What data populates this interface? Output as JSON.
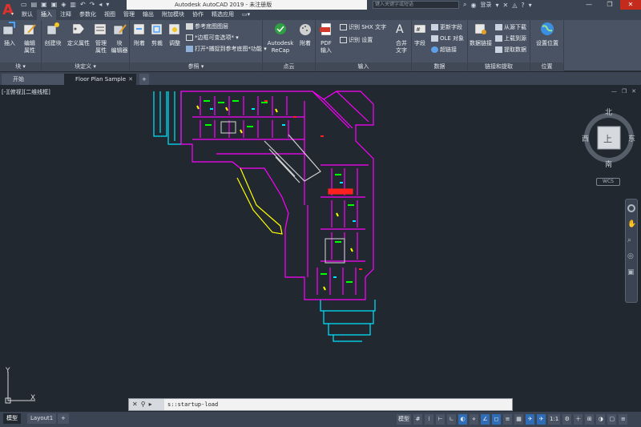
{
  "app": {
    "title": "Autodesk AutoCAD 2019 - 未注册版",
    "search_placeholder": "键入关键字或短语",
    "user_label": "登录"
  },
  "ribbon_tabs": [
    "默认",
    "插入",
    "注释",
    "参数化",
    "视图",
    "管理",
    "输出",
    "附加模块",
    "协作",
    "精选应用"
  ],
  "active_tab": "插入",
  "panels": {
    "block": {
      "label": "块 ▾",
      "insert": "插入",
      "edit_attr": "编辑\n属性"
    },
    "block_def": {
      "label": "块定义 ▾",
      "create": "创建块",
      "define_attr": "定义属性",
      "manage_attr": "管理\n属性",
      "block_editor": "块\n编辑器"
    },
    "reference": {
      "label": "参照 ▾",
      "attach": "附着",
      "clip": "剪裁",
      "adjust": "调整",
      "underlay_layers": "参考底图图层",
      "frame_variable": "*边框可变选项*",
      "snap_underlay": "打开*捕捉到参考底图*功能"
    },
    "point_cloud": {
      "label": "点云",
      "recap": "Autodesk\nReCap",
      "attach": "附着"
    },
    "import": {
      "label": "输入",
      "pdf_import": "PDF\n输入",
      "recognize_shx": "识别 SHX 文字",
      "recognize_settings": "识别 设置",
      "combine_text": "合并\n文字"
    },
    "data": {
      "label": "数据",
      "field": "字段",
      "update_fields": "更新字段",
      "ole_object": "OLE 对象",
      "hyperlink": "超链接"
    },
    "link_extract": {
      "label": "链接和提取",
      "data_link": "数据链接",
      "download_source": "从源下载",
      "upload_source": "上载到源",
      "extract_data": "提取数据"
    },
    "location": {
      "label": "位置",
      "set_location": "设置位置"
    }
  },
  "doc_tabs": {
    "start": "开始",
    "floor_plan": "Floor Plan Sample",
    "add": "+"
  },
  "viewport": {
    "label": "[-][俯视][二维线框]",
    "compass": {
      "north": "北",
      "south": "南",
      "east": "东",
      "west": "西",
      "center": "上"
    },
    "wcs": "WCS",
    "ucs_x": "X",
    "ucs_y": "Y"
  },
  "command_line": {
    "text": "s::startup-load"
  },
  "layout_tabs": [
    "模型",
    "Layout1",
    "+"
  ],
  "status_bar": {
    "model_label": "模型",
    "scale": "1:1"
  },
  "colors": {
    "magenta": "#ff00ff",
    "cyan": "#00e5ff",
    "yellow": "#ffff00",
    "green": "#00ff00",
    "red": "#ff2020",
    "white": "#ffffff",
    "canvas": "#212830"
  }
}
